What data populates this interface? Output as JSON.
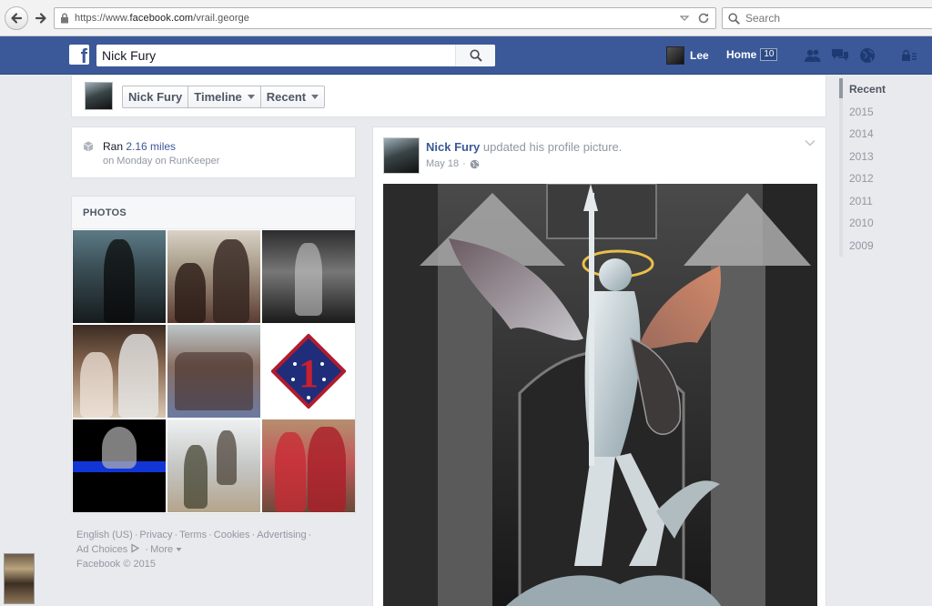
{
  "browser": {
    "url_prefix": "https://www.",
    "url_domain": "facebook.com",
    "url_path": "/vrail.george",
    "search_placeholder": "Search"
  },
  "fb_header": {
    "search_value": "Nick Fury",
    "user_name": "Lee",
    "home_label": "Home",
    "home_count": "10"
  },
  "timeline_nav": {
    "name": "Nick Fury",
    "timeline_label": "Timeline",
    "recent_label": "Recent"
  },
  "activity": {
    "action": "Ran",
    "distance": "2.16 miles",
    "detail": "on Monday on RunKeeper"
  },
  "photos": {
    "header": "PHOTOS"
  },
  "footer": {
    "links": [
      "English (US)",
      "Privacy",
      "Terms",
      "Cookies",
      "Advertising",
      "Ad Choices",
      "More"
    ],
    "copyright": "Facebook © 2015"
  },
  "story": {
    "author": "Nick Fury",
    "action": "updated his profile picture.",
    "date": "May 18"
  },
  "scrubber": {
    "years": [
      "Recent",
      "2015",
      "2014",
      "2013",
      "2012",
      "2011",
      "2010",
      "2009"
    ]
  },
  "colors": {
    "fb_blue": "#3b5998",
    "link_blue": "#3b5998",
    "muted": "#9197a3",
    "bg": "#e9eaed"
  }
}
